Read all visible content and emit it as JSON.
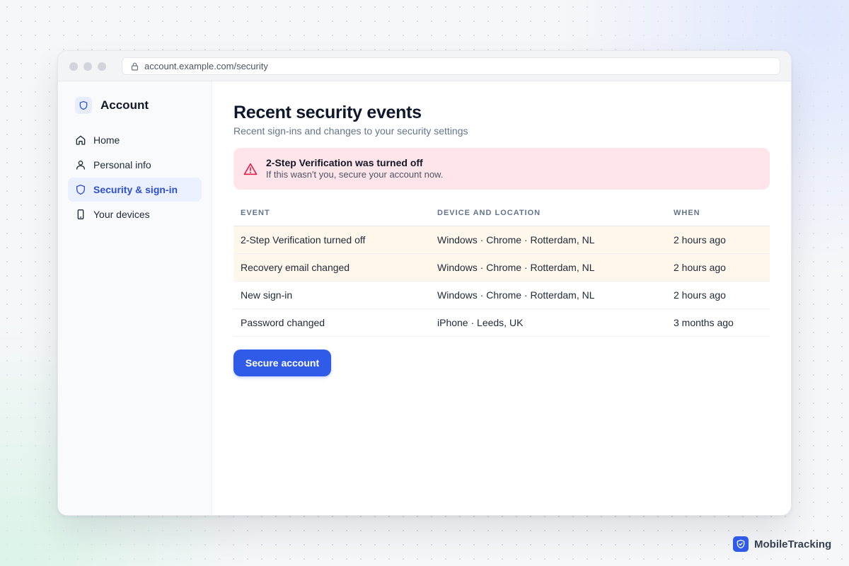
{
  "browser": {
    "url": "account.example.com/security"
  },
  "sidebar": {
    "title": "Account",
    "items": [
      {
        "label": "Home",
        "icon": "home-icon"
      },
      {
        "label": "Personal info",
        "icon": "user-icon"
      },
      {
        "label": "Security & sign-in",
        "icon": "shield-icon",
        "active": true
      },
      {
        "label": "Your devices",
        "icon": "phone-icon"
      }
    ]
  },
  "main": {
    "title": "Recent security events",
    "subtitle": "Recent sign-ins and changes to your security settings",
    "alert": {
      "title": "2-Step Verification was turned off",
      "text": "If this wasn't you, secure your account now."
    },
    "table": {
      "headers": [
        "EVENT",
        "DEVICE AND LOCATION",
        "WHEN"
      ],
      "rows": [
        {
          "event": "2-Step Verification turned off",
          "device": "Windows · Chrome · Rotterdam, NL",
          "when": "2 hours ago",
          "highlight": true
        },
        {
          "event": "Recovery email changed",
          "device": "Windows · Chrome · Rotterdam, NL",
          "when": "2 hours ago",
          "highlight": true
        },
        {
          "event": "New sign-in",
          "device": "Windows · Chrome · Rotterdam, NL",
          "when": "2 hours ago",
          "highlight": false
        },
        {
          "event": "Password changed",
          "device": "iPhone · Leeds, UK",
          "when": "3 months ago",
          "highlight": false
        }
      ]
    },
    "button_label": "Secure account"
  },
  "watermark": {
    "label": "MobileTracking"
  },
  "colors": {
    "accent": "#2f5be8",
    "active_nav_bg": "#eaf0fe",
    "alert_bg": "#ffe5ea",
    "alert_icon": "#e11d48",
    "highlight_row_bg": "#fff7ec"
  }
}
